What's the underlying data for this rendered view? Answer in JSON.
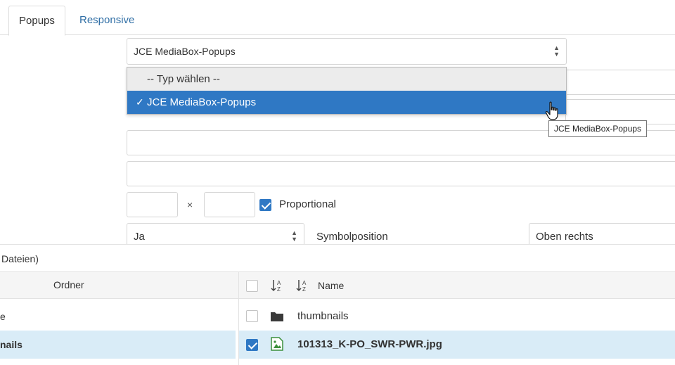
{
  "tabs": [
    {
      "label": "Popups",
      "active": true
    },
    {
      "label": "Responsive",
      "active": false
    }
  ],
  "popup_type_select": {
    "value": "JCE MediaBox-Popups"
  },
  "dropdown": {
    "options": [
      {
        "label": "-- Typ wählen --",
        "selected": false
      },
      {
        "label": "JCE MediaBox-Popups",
        "selected": true
      }
    ],
    "check_glyph": "✓"
  },
  "tooltip": "JCE MediaBox-Popups",
  "dimensions": {
    "times": "×",
    "proportional_label": "Proportional",
    "proportional_checked": true
  },
  "row_selects": {
    "first_value": "Ja",
    "icon_position_label": "Symbolposition",
    "icon_position_value": "Oben rechts"
  },
  "file_browser": {
    "summary": "Dateien)",
    "folder_header": "Ordner",
    "folders": [
      {
        "label": "e",
        "active": false
      },
      {
        "label": "nails",
        "active": true
      }
    ],
    "name_header": "Name",
    "files": [
      {
        "name": "thumbnails",
        "type": "folder",
        "checked": false
      },
      {
        "name": "101313_K-PO_SWR-PWR.jpg",
        "type": "image",
        "checked": true
      }
    ]
  },
  "colors": {
    "accent": "#2f78c4",
    "link": "#2f6ea5",
    "row_highlight": "#d9ecf7"
  }
}
